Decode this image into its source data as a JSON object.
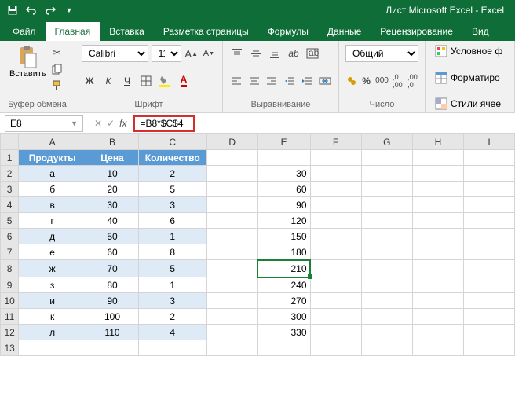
{
  "app_title": "Лист Microsoft Excel - Excel",
  "tabs": {
    "file": "Файл",
    "home": "Главная",
    "insert": "Вставка",
    "layout": "Разметка страницы",
    "formulas": "Формулы",
    "data": "Данные",
    "review": "Рецензирование",
    "view": "Вид"
  },
  "ribbon": {
    "paste": "Вставить",
    "clipboard": "Буфер обмена",
    "font_group": "Шрифт",
    "align_group": "Выравнивание",
    "number_group": "Число",
    "font_name": "Calibri",
    "font_size": "11",
    "number_format": "Общий",
    "cond": "Условное ф",
    "fmt_table": "Форматиро",
    "styles": "Стили ячее"
  },
  "namebox": "E8",
  "formula": "=B8*$C$4",
  "cols": [
    "A",
    "B",
    "C",
    "D",
    "E",
    "F",
    "G",
    "H",
    "I"
  ],
  "headers": {
    "a": "Продукты",
    "b": "Цена",
    "c": "Количество"
  },
  "rows": [
    {
      "n": 2,
      "a": "а",
      "b": "10",
      "c": "2",
      "e": "30"
    },
    {
      "n": 3,
      "a": "б",
      "b": "20",
      "c": "5",
      "e": "60"
    },
    {
      "n": 4,
      "a": "в",
      "b": "30",
      "c": "3",
      "e": "90"
    },
    {
      "n": 5,
      "a": "г",
      "b": "40",
      "c": "6",
      "e": "120"
    },
    {
      "n": 6,
      "a": "д",
      "b": "50",
      "c": "1",
      "e": "150"
    },
    {
      "n": 7,
      "a": "е",
      "b": "60",
      "c": "8",
      "e": "180"
    },
    {
      "n": 8,
      "a": "ж",
      "b": "70",
      "c": "5",
      "e": "210"
    },
    {
      "n": 9,
      "a": "з",
      "b": "80",
      "c": "1",
      "e": "240"
    },
    {
      "n": 10,
      "a": "и",
      "b": "90",
      "c": "3",
      "e": "270"
    },
    {
      "n": 11,
      "a": "к",
      "b": "100",
      "c": "2",
      "e": "300"
    },
    {
      "n": 12,
      "a": "л",
      "b": "110",
      "c": "4",
      "e": "330"
    }
  ]
}
